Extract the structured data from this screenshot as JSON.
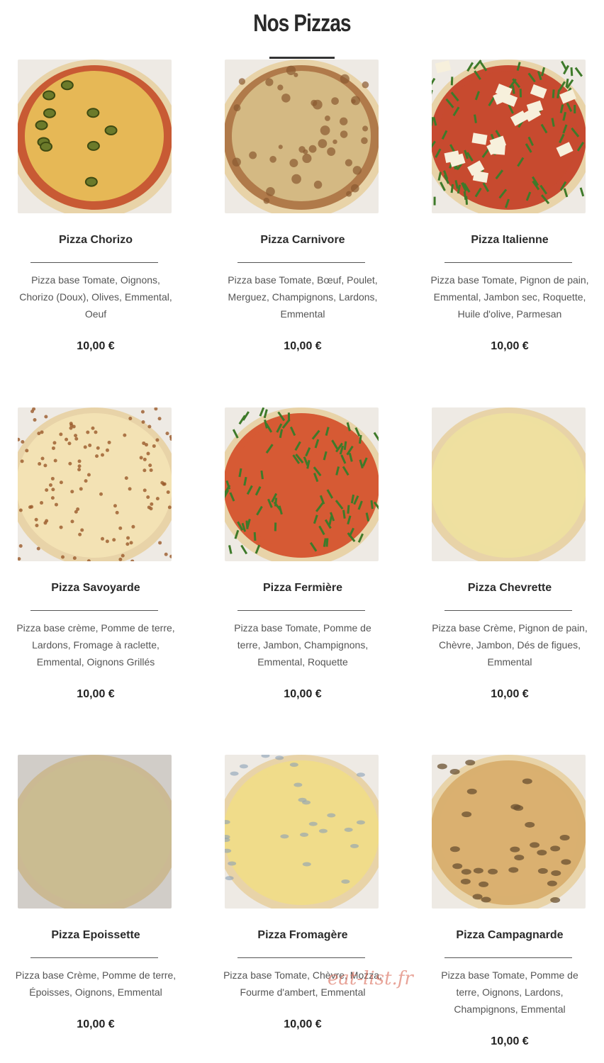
{
  "page": {
    "title": "Nos Pizzas"
  },
  "watermark": "eat-list.fr",
  "pizzas": [
    {
      "name": "Pizza Chorizo",
      "desc": [
        "Pizza base Tomate, Oignons,",
        "Chorizo (Doux), Olives, Emmental,",
        "Oeuf"
      ],
      "price": "10,00 €",
      "image": "pizza-chorizo-photo"
    },
    {
      "name": "Pizza Carnivore",
      "desc": [
        "Pizza base Tomate, Bœuf, Poulet,",
        "Merguez, Champignons, Lardons,",
        "Emmental"
      ],
      "price": "10,00 €",
      "image": "pizza-carnivore-photo"
    },
    {
      "name": "Pizza Italienne",
      "desc": [
        "Pizza base Tomate, Pignon de pain,",
        "Emmental, Jambon sec, Roquette,",
        "Huile d'olive, Parmesan"
      ],
      "price": "10,00 €",
      "image": "pizza-italienne-photo"
    },
    {
      "name": "Pizza Savoyarde",
      "desc": [
        "Pizza base crème, Pomme de terre,",
        "Lardons, Fromage à raclette,",
        "Emmental, Oignons Grillés"
      ],
      "price": "10,00 €",
      "image": "pizza-savoyarde-photo"
    },
    {
      "name": "Pizza Fermière",
      "desc": [
        "Pizza base Tomate, Pomme de",
        "terre, Jambon, Champignons,",
        "Emmental, Roquette"
      ],
      "price": "10,00 €",
      "image": "pizza-fermiere-photo"
    },
    {
      "name": "Pizza Chevrette",
      "desc": [
        "Pizza base Crème, Pignon de pain,",
        "Chèvre, Jambon, Dés de figues,",
        "Emmental"
      ],
      "price": "10,00 €",
      "image": "pizza-chevrette-photo"
    },
    {
      "name": "Pizza Epoissette",
      "desc": [
        "Pizza base Crème, Pomme de terre,",
        "Époisses, Oignons, Emmental"
      ],
      "price": "10,00 €",
      "image": "pizza-epoissette-photo"
    },
    {
      "name": "Pizza Fromagère",
      "desc": [
        "Pizza base Tomate, Chèvre, Mozza,",
        "Fourme d'ambert, Emmental"
      ],
      "price": "10,00 €",
      "image": "pizza-fromagere-photo"
    },
    {
      "name": "Pizza Campagnarde",
      "desc": [
        "Pizza base Tomate, Pomme de",
        "terre, Oignons, Lardons,",
        "Champignons, Emmental"
      ],
      "price": "10,00 €",
      "image": "pizza-campagnarde-photo"
    }
  ],
  "colors": {
    "title": "#2a2a2a",
    "text": "#555555",
    "crust": "#e8d3a8",
    "tomato": "#c0482f",
    "cheese": "#f0d77a",
    "arugula": "#3e7a2a"
  }
}
